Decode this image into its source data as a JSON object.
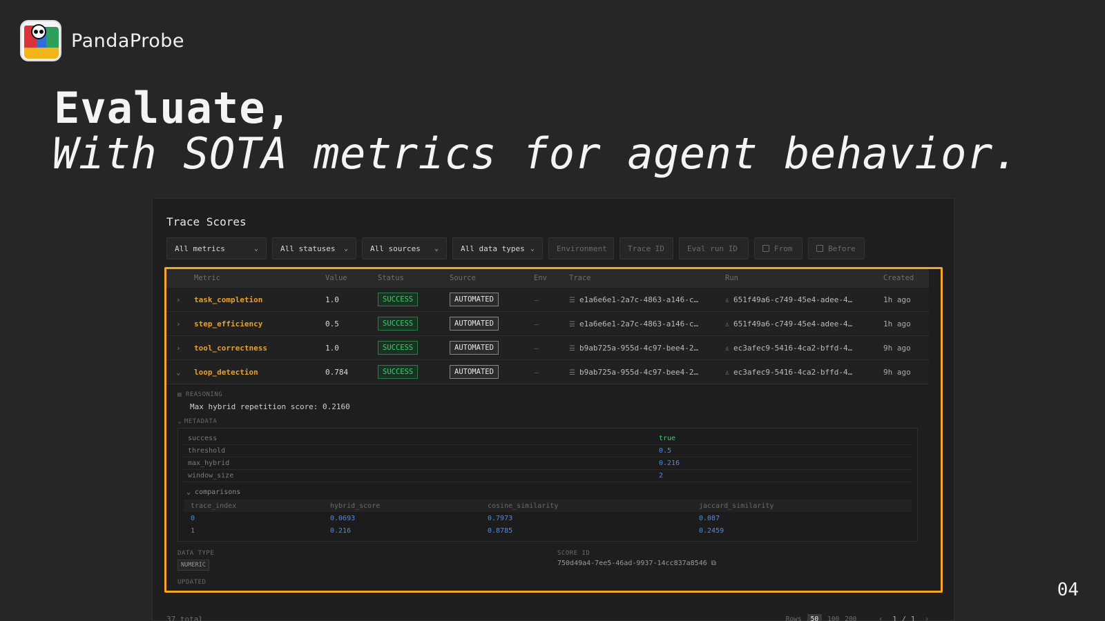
{
  "brand": {
    "name": "PandaProbe"
  },
  "hero": {
    "line1": "Evaluate,",
    "line2": "With SOTA metrics for agent behavior."
  },
  "slide_number": "04",
  "panel": {
    "title": "Trace Scores",
    "filters": [
      {
        "label": "All metrics",
        "type": "select"
      },
      {
        "label": "All statuses",
        "type": "select"
      },
      {
        "label": "All sources",
        "type": "select"
      },
      {
        "label": "All data types",
        "type": "select"
      },
      {
        "label": "Environment",
        "type": "input"
      },
      {
        "label": "Trace ID",
        "type": "input"
      },
      {
        "label": "Eval run ID",
        "type": "input"
      },
      {
        "label": "From",
        "type": "date"
      },
      {
        "label": "Before",
        "type": "date"
      }
    ],
    "columns": [
      "Metric",
      "Value",
      "Status",
      "Source",
      "Env",
      "Trace",
      "Run",
      "Created"
    ],
    "rows": [
      {
        "metric": "task_completion",
        "value": "1.0",
        "status": "SUCCESS",
        "source": "AUTOMATED",
        "env": "–",
        "trace": "e1a6e6e1-2a7c-4863-a146-c…",
        "run": "651f49a6-c749-45e4-adee-4…",
        "created": "1h ago",
        "expander": "›"
      },
      {
        "metric": "step_efficiency",
        "value": "0.5",
        "status": "SUCCESS",
        "source": "AUTOMATED",
        "env": "–",
        "trace": "e1a6e6e1-2a7c-4863-a146-c…",
        "run": "651f49a6-c749-45e4-adee-4…",
        "created": "1h ago",
        "expander": "›"
      },
      {
        "metric": "tool_correctness",
        "value": "1.0",
        "status": "SUCCESS",
        "source": "AUTOMATED",
        "env": "–",
        "trace": "b9ab725a-955d-4c97-bee4-2…",
        "run": "ec3afec9-5416-4ca2-bffd-4…",
        "created": "9h ago",
        "expander": "›"
      },
      {
        "metric": "loop_detection",
        "value": "0.784",
        "status": "SUCCESS",
        "source": "AUTOMATED",
        "env": "–",
        "trace": "b9ab725a-955d-4c97-bee4-2…",
        "run": "ec3afec9-5416-4ca2-bffd-4…",
        "created": "9h ago",
        "expander": "⌄"
      }
    ],
    "detail": {
      "reasoning_label": "REASONING",
      "reasoning_text": "Max hybrid repetition score: 0.2160",
      "metadata_label": "METADATA",
      "metadata": [
        {
          "key": "success",
          "value": "true"
        },
        {
          "key": "threshold",
          "value": "0.5"
        },
        {
          "key": "max_hybrid",
          "value": "0.216"
        },
        {
          "key": "window_size",
          "value": "2"
        }
      ],
      "comparisons_label": "comparisons",
      "comparison_columns": [
        "trace_index",
        "hybrid_score",
        "cosine_similarity",
        "jaccard_similarity"
      ],
      "comparisons": [
        [
          "0",
          "0.0693",
          "0.7973",
          "0.087"
        ],
        [
          "1",
          "0.216",
          "0.8785",
          "0.2459"
        ]
      ],
      "data_type_label": "DATA TYPE",
      "data_type": "NUMERIC",
      "score_id_label": "SCORE ID",
      "score_id": "750d49a4-7ee5-46ad-9937-14cc837a8546",
      "updated_label": "UPDATED"
    },
    "pager": {
      "total": "37 total",
      "rows_label": "Rows",
      "row_options": [
        "50",
        "100",
        "200"
      ],
      "active_rows": "50",
      "prev": "‹",
      "page": "1 / 1",
      "next": "›"
    }
  },
  "colors": {
    "accent": "#f5a623",
    "metric": "#e7a12c",
    "success": "#3ccf67",
    "value_blue": "#4a8bf0"
  }
}
